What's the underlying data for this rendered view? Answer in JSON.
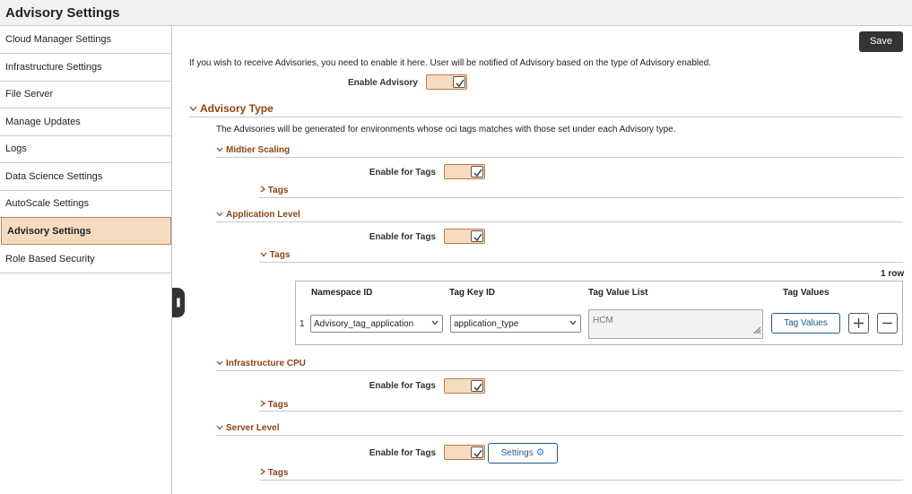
{
  "header": {
    "title": "Advisory Settings"
  },
  "sidebar": {
    "items": [
      {
        "label": "Cloud Manager Settings"
      },
      {
        "label": "Infrastructure Settings"
      },
      {
        "label": "File Server"
      },
      {
        "label": "Manage Updates"
      },
      {
        "label": "Logs"
      },
      {
        "label": "Data Science Settings"
      },
      {
        "label": "AutoScale Settings"
      },
      {
        "label": "Advisory Settings"
      },
      {
        "label": "Role Based Security"
      }
    ],
    "active_index": 7
  },
  "toolbar": {
    "save_label": "Save"
  },
  "intro": {
    "text": "If you wish to receive Advisories, you need to enable it here. User will be notified of Advisory based on the type of Advisory enabled.",
    "enable_label": "Enable Advisory",
    "enable_checked": true
  },
  "advisory_type": {
    "title": "Advisory Type",
    "description": "The Advisories will be generated for environments whose oci tags matches with those set under each Advisory type.",
    "sections": {
      "midtier": {
        "title": "Midtier Scaling",
        "enable_label": "Enable for Tags",
        "tags_label": "Tags"
      },
      "application": {
        "title": "Application Level",
        "enable_label": "Enable for Tags",
        "tags_label": "Tags"
      },
      "infra_cpu": {
        "title": "Infrastructure CPU",
        "enable_label": "Enable for Tags",
        "tags_label": "Tags"
      },
      "server": {
        "title": "Server Level",
        "enable_label": "Enable for Tags",
        "settings_label": "Settings",
        "tags_label": "Tags"
      }
    }
  },
  "tags_table": {
    "row_count": "1 row",
    "columns": [
      "Namespace ID",
      "Tag Key ID",
      "Tag Value List",
      "Tag Values"
    ],
    "rows": [
      {
        "index": "1",
        "namespace_id": "Advisory_tag_application",
        "tag_key_id": "application_type",
        "tag_value_list": "HCM",
        "tag_values_button": "Tag Values"
      }
    ]
  },
  "colors": {
    "accent": "#8b4513",
    "toggle_bg": "#f5dcc0",
    "dark_button": "#333333",
    "link": "#1f5a8a"
  }
}
